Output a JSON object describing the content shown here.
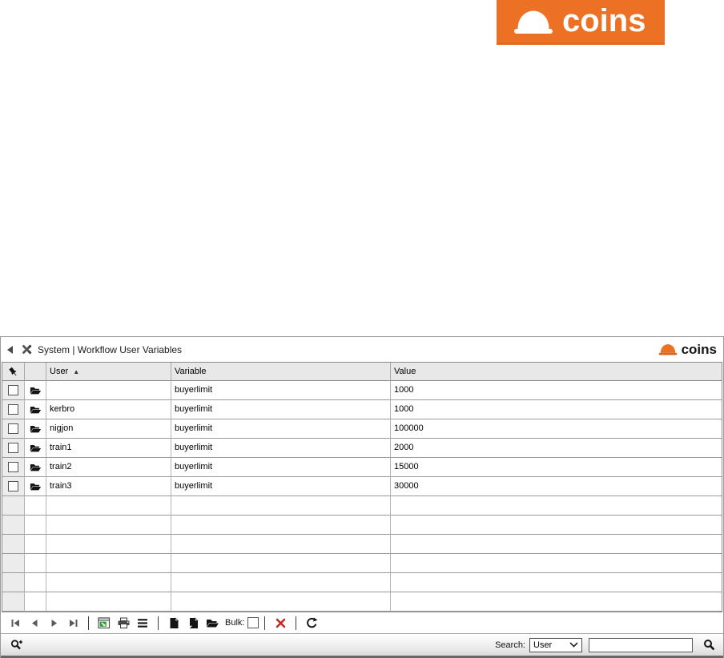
{
  "brand": {
    "logo_text": "coins",
    "header_logo_text": "coins",
    "orange": "#ED7125"
  },
  "header": {
    "title": "System | Workflow User Variables"
  },
  "table": {
    "columns": [
      "User",
      "Variable",
      "Value"
    ],
    "sort_column": "User",
    "sort_indicator": "▲",
    "rows": [
      {
        "user": "",
        "variable": "buyerlimit",
        "value": "1000"
      },
      {
        "user": "kerbro",
        "variable": "buyerlimit",
        "value": "1000"
      },
      {
        "user": "nigjon",
        "variable": "buyerlimit",
        "value": "100000"
      },
      {
        "user": "train1",
        "variable": "buyerlimit",
        "value": "2000"
      },
      {
        "user": "train2",
        "variable": "buyerlimit",
        "value": "15000"
      },
      {
        "user": "train3",
        "variable": "buyerlimit",
        "value": "30000"
      }
    ],
    "empty_row_count": 6
  },
  "toolbar": {
    "bulk_label": "Bulk:",
    "bulk_checked": false,
    "delete_red": "#C62828",
    "export_green": "#2E9E35"
  },
  "footer": {
    "search_label": "Search:",
    "search_category": "User",
    "search_value": "",
    "search_placeholder": ""
  }
}
